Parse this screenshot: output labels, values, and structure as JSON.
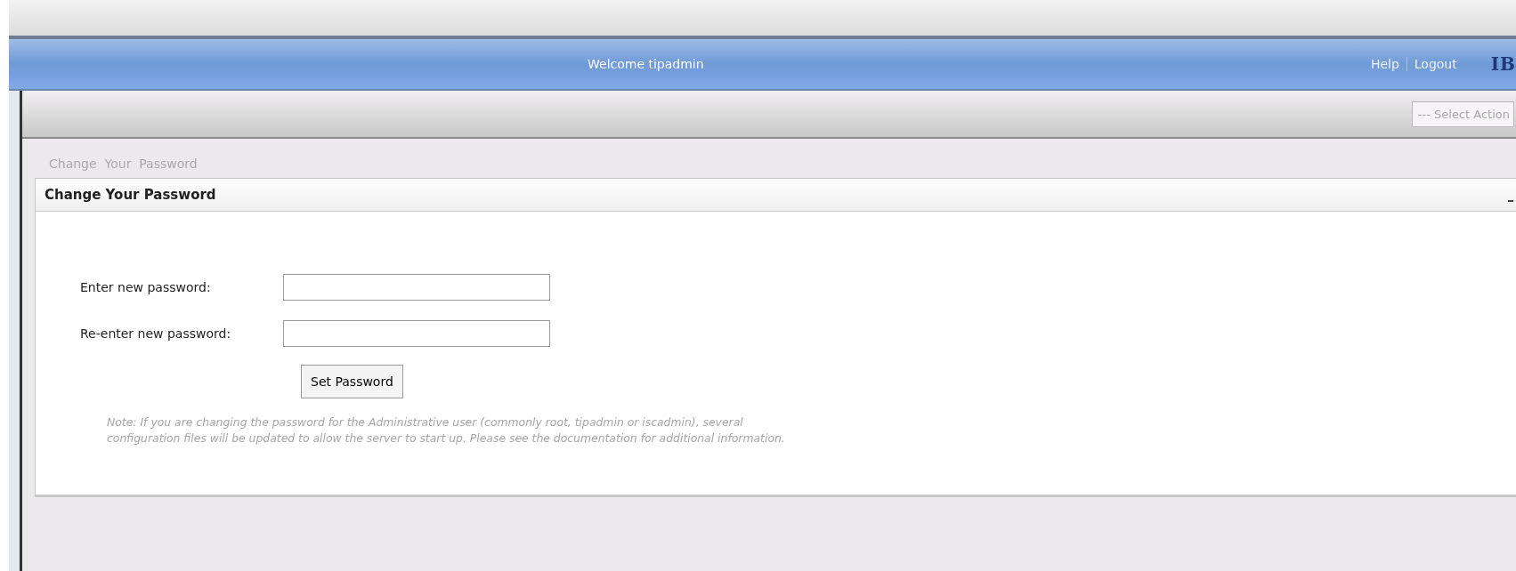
{
  "header": {
    "welcome": "Welcome tipadmin",
    "links": [
      "Help",
      "Logout"
    ],
    "logo": "IB"
  },
  "toolbar": {
    "select_action": "--- Select Action"
  },
  "breadcrumb": "Change  Your  Password",
  "panel": {
    "title": "Change Your Password",
    "fields": [
      {
        "label": "Enter new password:"
      },
      {
        "label": "Re-enter new password:"
      }
    ],
    "button": "Set Password",
    "note": "Note: If you are changing the password for the Administrative user (commonly root, tipadmin or iscadmin), several\nconfiguration files will be updated to allow the server to start up. Please see the documentation for additional information."
  }
}
